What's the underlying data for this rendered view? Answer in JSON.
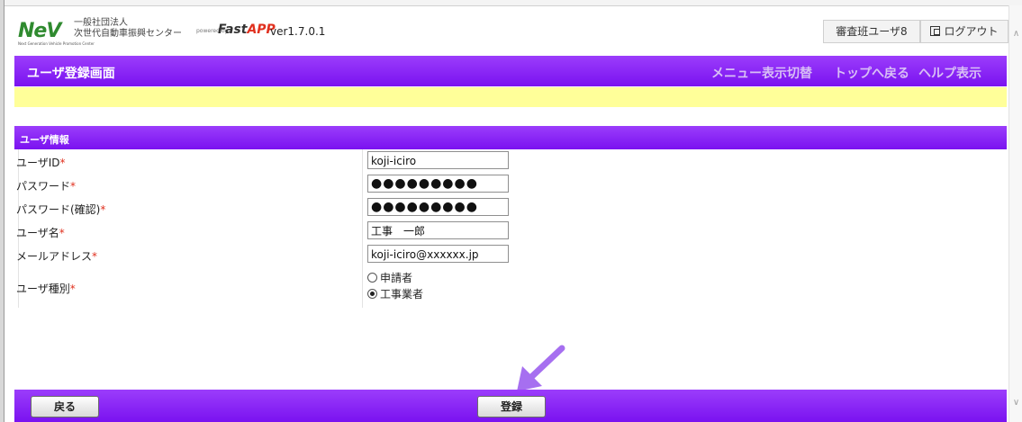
{
  "header": {
    "logo_text": "NeV",
    "logo_subtext": "Next Generation Vehicle Promotion Center",
    "org_line1": "一般社団法人",
    "org_line2": "次世代自動車振興センター",
    "powered_by": "powered by",
    "brand_fast": "Fast",
    "brand_app": "APP",
    "version": "ver1.7.0.1",
    "user_label": "審査班ユーザ8",
    "logout_label": "ログアウト",
    "logout_icon": "logout-icon"
  },
  "titlebar": {
    "title": "ユーザ登録画面",
    "nav": [
      "メニュー表示切替",
      "トップへ戻る",
      "ヘルプ表示"
    ]
  },
  "section": {
    "title": "ユーザ情報"
  },
  "form": {
    "required_mark": "*",
    "fields": [
      {
        "label": "ユーザID",
        "value": "koji-iciro"
      },
      {
        "label": "パスワード",
        "value": "●●●●●●●●●"
      },
      {
        "label": "パスワード(確認)",
        "value": "●●●●●●●●●"
      },
      {
        "label": "ユーザ名",
        "value": "工事　一郎"
      },
      {
        "label": "メールアドレス",
        "value": "koji-iciro@xxxxxx.jp"
      }
    ],
    "user_type": {
      "label": "ユーザ種別",
      "options": [
        {
          "label": "申請者",
          "selected": false
        },
        {
          "label": "工事業者",
          "selected": true
        }
      ]
    }
  },
  "footer": {
    "back_label": "戻る",
    "register_label": "登録"
  },
  "colors": {
    "accent_purple": "#8a1ff6",
    "message_bar": "#ffff99",
    "required": "#e0301e",
    "arrow": "#a66ff0"
  }
}
